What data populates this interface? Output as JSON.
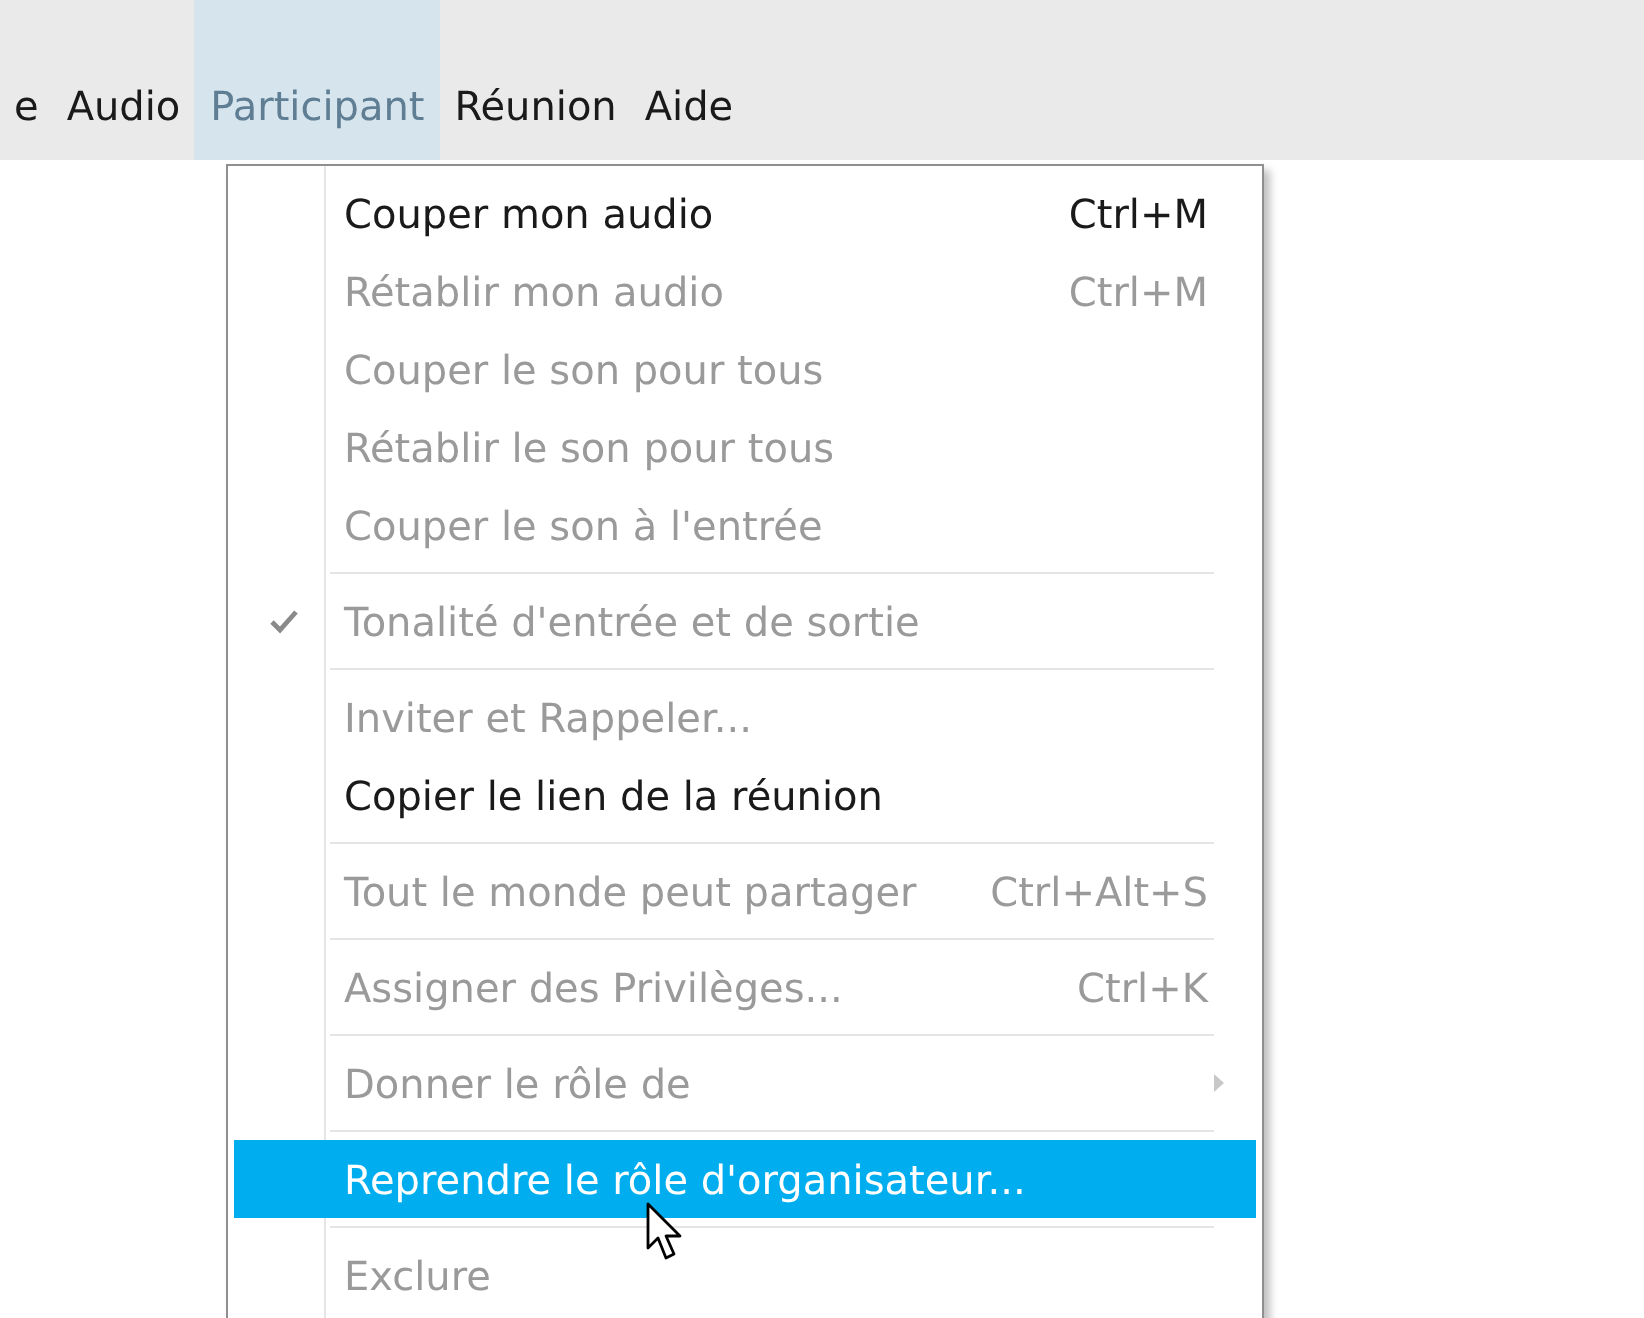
{
  "menubar": [
    {
      "label": "e",
      "selected": false
    },
    {
      "label": "Audio",
      "selected": false
    },
    {
      "label": "Participant",
      "selected": true
    },
    {
      "label": "Réunion",
      "selected": false
    },
    {
      "label": "Aide",
      "selected": false
    }
  ],
  "menu": {
    "items": [
      {
        "kind": "item",
        "label": "Couper mon audio",
        "shortcut": "Ctrl+M",
        "disabled": false,
        "checked": false,
        "selected": false,
        "submenu": false
      },
      {
        "kind": "item",
        "label": "Rétablir mon audio",
        "shortcut": "Ctrl+M",
        "disabled": true,
        "checked": false,
        "selected": false,
        "submenu": false
      },
      {
        "kind": "item",
        "label": "Couper le son pour tous",
        "disabled": true,
        "checked": false,
        "selected": false,
        "submenu": false
      },
      {
        "kind": "item",
        "label": "Rétablir le son pour tous",
        "disabled": true,
        "checked": false,
        "selected": false,
        "submenu": false
      },
      {
        "kind": "item",
        "label": "Couper le son à l'entrée",
        "disabled": true,
        "checked": false,
        "selected": false,
        "submenu": false
      },
      {
        "kind": "separator"
      },
      {
        "kind": "item",
        "label": "Tonalité d'entrée et de sortie",
        "disabled": true,
        "checked": true,
        "selected": false,
        "submenu": false
      },
      {
        "kind": "separator"
      },
      {
        "kind": "item",
        "label": "Inviter et Rappeler...",
        "disabled": true,
        "checked": false,
        "selected": false,
        "submenu": false
      },
      {
        "kind": "item",
        "label": "Copier le lien de la réunion",
        "disabled": false,
        "checked": false,
        "selected": false,
        "submenu": false
      },
      {
        "kind": "separator"
      },
      {
        "kind": "item",
        "label": "Tout le monde peut partager",
        "shortcut": "Ctrl+Alt+S",
        "disabled": true,
        "checked": false,
        "selected": false,
        "submenu": false
      },
      {
        "kind": "separator"
      },
      {
        "kind": "item",
        "label": "Assigner des Privilèges...",
        "shortcut": "Ctrl+K",
        "disabled": true,
        "checked": false,
        "selected": false,
        "submenu": false
      },
      {
        "kind": "separator"
      },
      {
        "kind": "item",
        "label": "Donner le rôle de",
        "disabled": true,
        "checked": false,
        "selected": false,
        "submenu": true
      },
      {
        "kind": "separator"
      },
      {
        "kind": "item",
        "label": "Reprendre le rôle d'organisateur...",
        "disabled": false,
        "checked": false,
        "selected": true,
        "submenu": false
      },
      {
        "kind": "separator"
      },
      {
        "kind": "item",
        "label": "Exclure",
        "disabled": true,
        "checked": false,
        "selected": false,
        "submenu": false
      }
    ]
  }
}
